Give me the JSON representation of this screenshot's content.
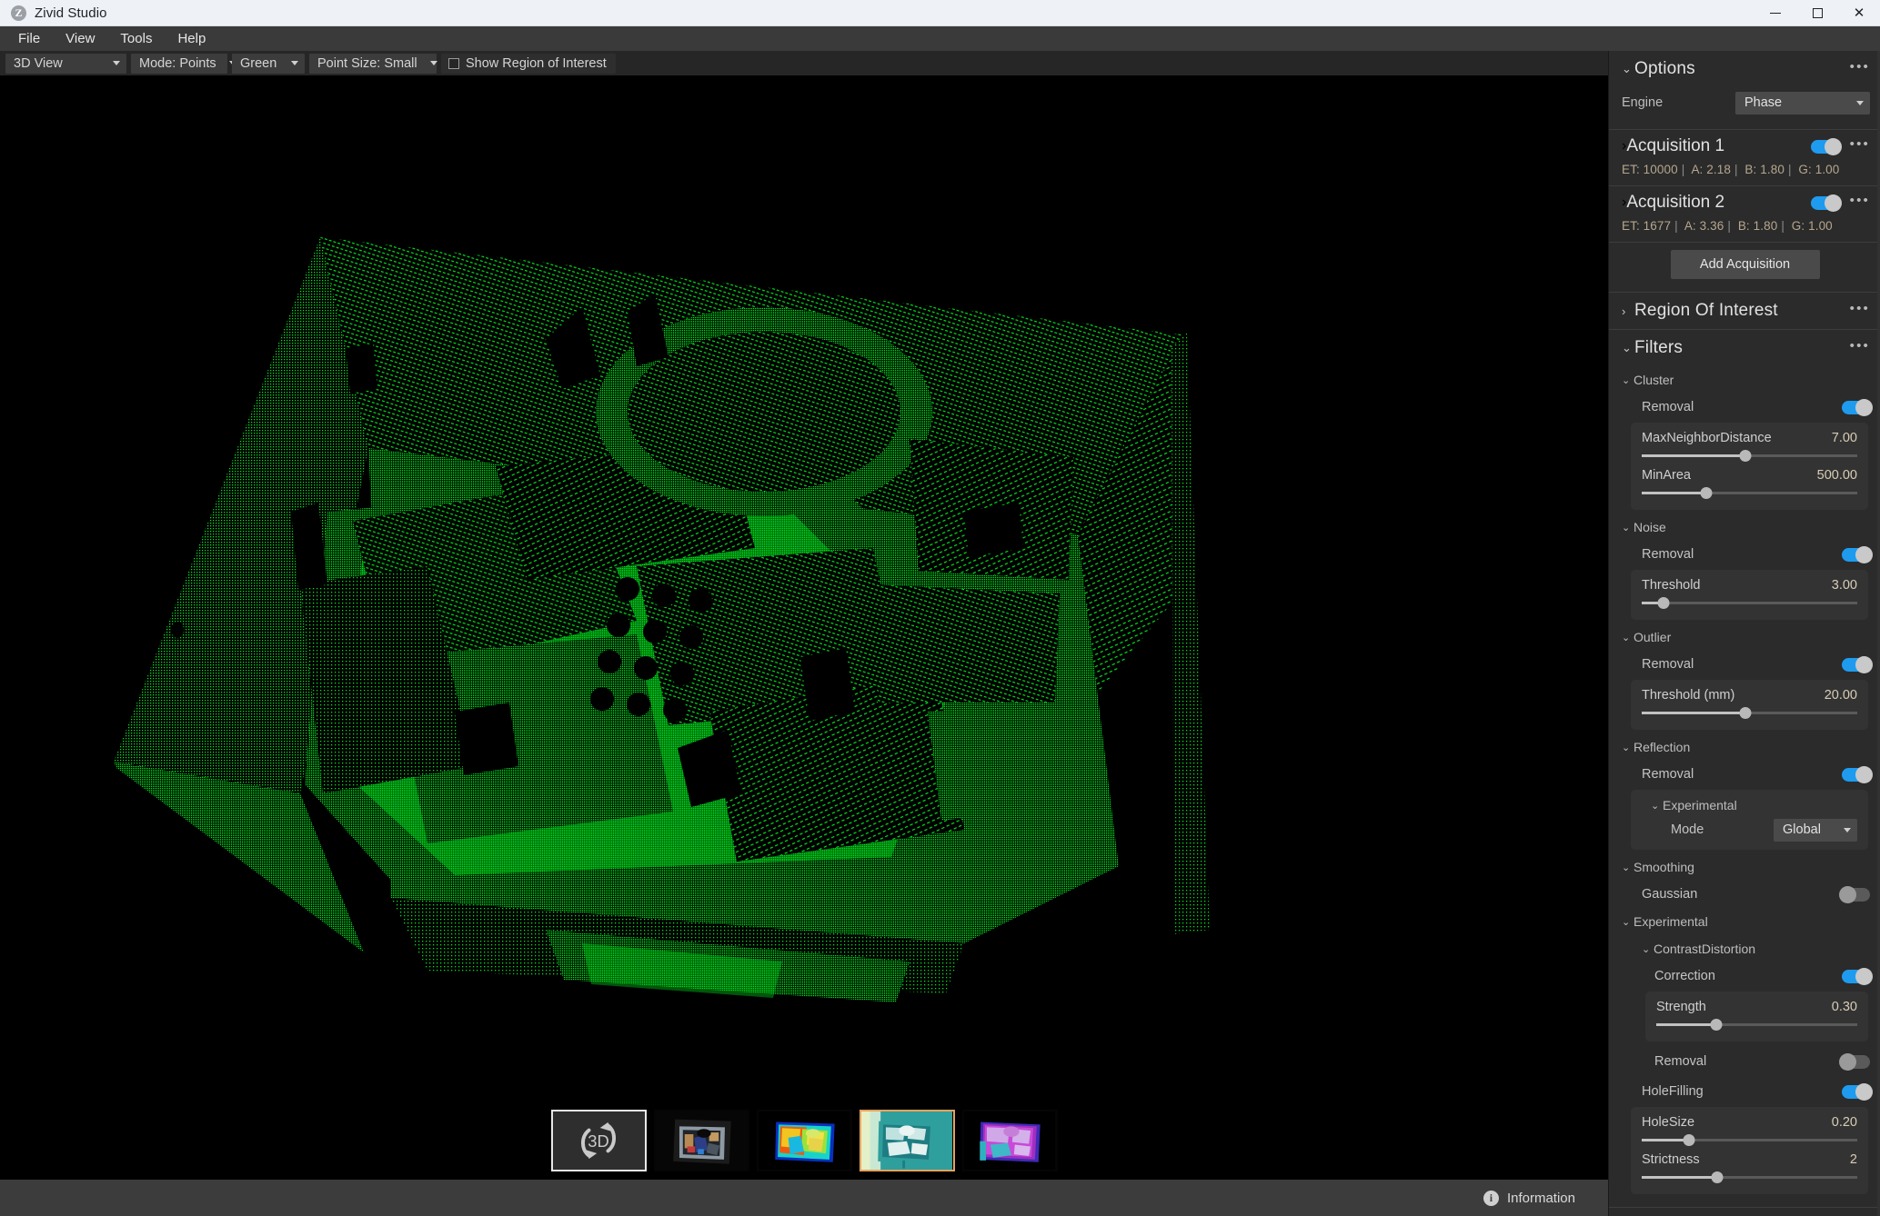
{
  "window": {
    "title": "Zivid Studio",
    "app_icon": "zivid-z-icon",
    "minimize_label": "Minimize",
    "maximize_label": "Maximize",
    "close_label": "Close"
  },
  "menubar": {
    "items": [
      {
        "label": "File"
      },
      {
        "label": "View"
      },
      {
        "label": "Tools"
      },
      {
        "label": "Help"
      }
    ]
  },
  "toolbar": {
    "view_mode": "3D View",
    "render_mode": "Mode: Points",
    "color_scheme": "Green",
    "point_size": "Point Size: Small",
    "show_roi_label": "Show Region of Interest",
    "show_roi_checked": false
  },
  "viewport": {
    "name": "3d-point-cloud-viewport",
    "point_color": "#00e21c",
    "background": "#000000"
  },
  "thumbnails": {
    "items": [
      {
        "id": "3d",
        "label": "3D",
        "type": "3d-view",
        "selected": true
      },
      {
        "id": "rgb",
        "label": "",
        "type": "rgb-image",
        "selected": false
      },
      {
        "id": "depth",
        "label": "",
        "type": "depth-map-jet",
        "selected": false
      },
      {
        "id": "snr",
        "label": "",
        "type": "snr-map-teal",
        "selected": true
      },
      {
        "id": "normals",
        "label": "",
        "type": "normals-map-magenta",
        "selected": false
      }
    ]
  },
  "statusbar": {
    "information_label": "Information",
    "info_icon": "info-circle-icon"
  },
  "panel": {
    "options": {
      "title": "Options",
      "expanded": true,
      "menu_icon": "overflow-dots-icon",
      "engine_label": "Engine",
      "engine_value": "Phase"
    },
    "acquisitions": [
      {
        "title": "Acquisition 1",
        "expanded": false,
        "enabled": true,
        "params": {
          "et_label": "ET:",
          "et": "10000",
          "a_label": "A:",
          "a": "2.18",
          "b_label": "B:",
          "b": "1.80",
          "g_label": "G:",
          "g": "1.00"
        }
      },
      {
        "title": "Acquisition 2",
        "expanded": false,
        "enabled": true,
        "params": {
          "et_label": "ET:",
          "et": "1677",
          "a_label": "A:",
          "a": "3.36",
          "b_label": "B:",
          "b": "1.80",
          "g_label": "G:",
          "g": "1.00"
        }
      }
    ],
    "add_acquisition_label": "Add Acquisition",
    "region_of_interest": {
      "title": "Region Of Interest",
      "expanded": false
    },
    "filters": {
      "title": "Filters",
      "expanded": true,
      "groups": [
        {
          "name": "Cluster",
          "expanded": true,
          "toggle_label": "Removal",
          "toggle_on": true,
          "sliders": [
            {
              "name": "MaxNeighborDistance",
              "value": "7.00",
              "percent": 48
            },
            {
              "name": "MinArea",
              "value": "500.00",
              "percent": 30
            }
          ]
        },
        {
          "name": "Noise",
          "expanded": true,
          "toggle_label": "Removal",
          "toggle_on": true,
          "sliders": [
            {
              "name": "Threshold",
              "value": "3.00",
              "percent": 10
            }
          ]
        },
        {
          "name": "Outlier",
          "expanded": true,
          "toggle_label": "Removal",
          "toggle_on": true,
          "sliders": [
            {
              "name": "Threshold (mm)",
              "value": "20.00",
              "percent": 48
            }
          ]
        },
        {
          "name": "Reflection",
          "expanded": true,
          "toggle_label": "Removal",
          "toggle_on": true,
          "sub_group": "Experimental",
          "mode_label": "Mode",
          "mode_value": "Global"
        },
        {
          "name": "Smoothing",
          "expanded": true,
          "toggle_label": "Gaussian",
          "toggle_on": false
        },
        {
          "name": "Experimental",
          "expanded": true,
          "sub_group": "ContrastDistortion",
          "correction_label": "Correction",
          "correction_on": true,
          "strength": {
            "name": "Strength",
            "value": "0.30",
            "percent": 30
          },
          "removal_label": "Removal",
          "removal_on": false,
          "holefilling_label": "HoleFilling",
          "holefilling_on": true,
          "holefilling_sliders": [
            {
              "name": "HoleSize",
              "value": "0.20",
              "percent": 22
            },
            {
              "name": "Strictness",
              "value": "2",
              "percent": 35
            }
          ]
        }
      ]
    }
  },
  "colors": {
    "accent": "#1e9bef",
    "panel_bg": "#2b2b2b",
    "card_bg": "#333333",
    "value_text": "#d8cdb6",
    "thumb_selected_border": "#e8a35c"
  }
}
